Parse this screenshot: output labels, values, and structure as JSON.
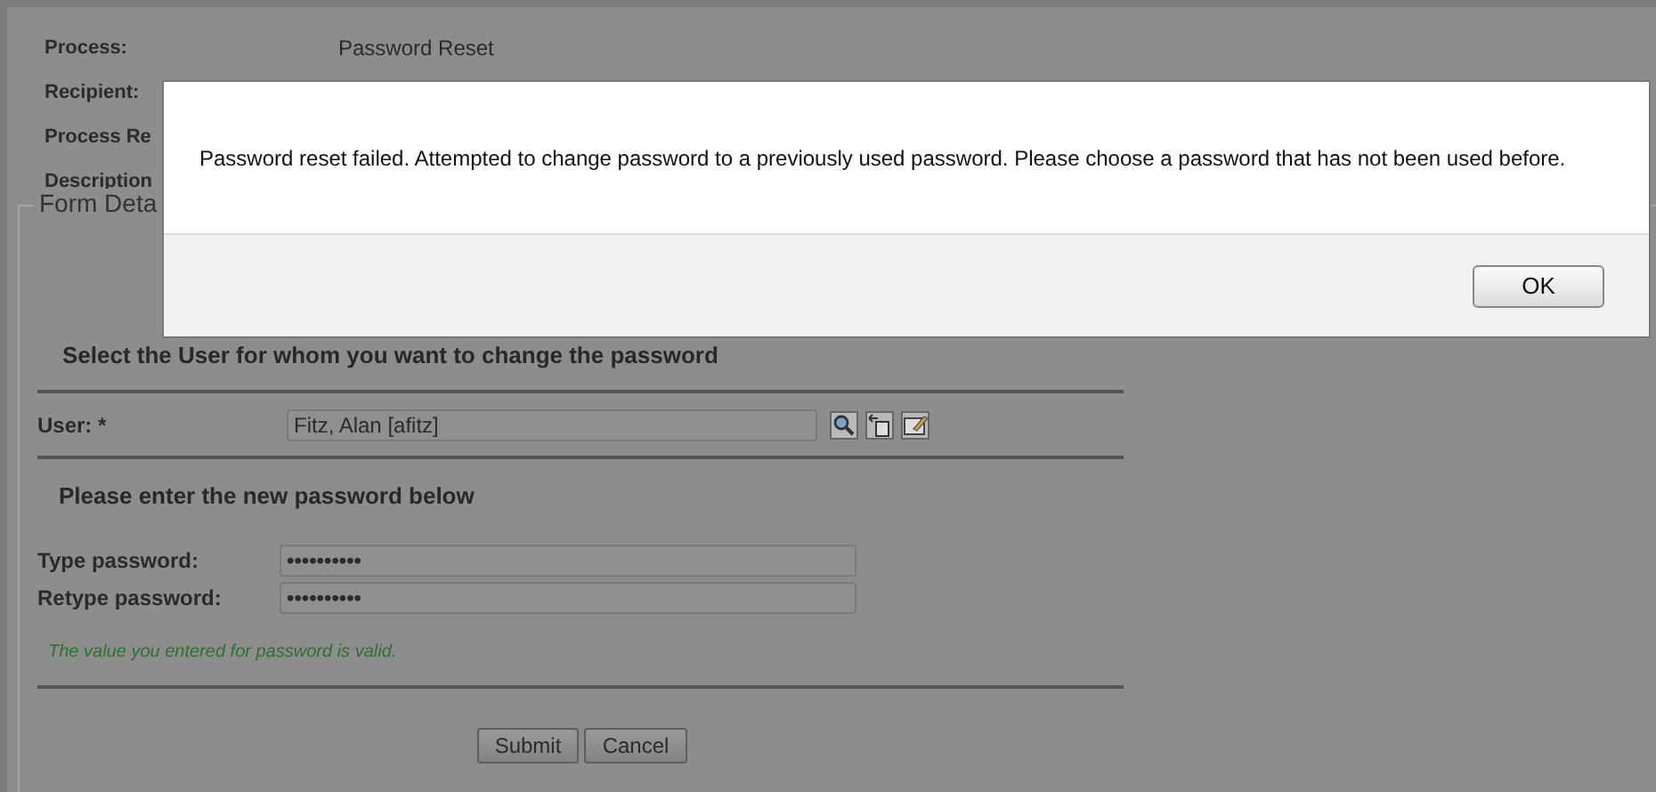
{
  "summary": [
    {
      "label": "Process:",
      "value": "Password Reset"
    },
    {
      "label": "Recipient:"
    },
    {
      "label": "Process Re"
    },
    {
      "label": "Description"
    }
  ],
  "fieldset": {
    "legend": "Form Deta"
  },
  "user_section": {
    "heading": "Select the User for whom you want to change the password",
    "label": "User: *",
    "value": "Fitz, Alan [afitz]"
  },
  "password_section": {
    "heading": "Please enter the new password below",
    "fields": [
      {
        "label": "Type password:",
        "value": "••••••••••"
      },
      {
        "label": "Retype password:",
        "value": "••••••••••"
      }
    ],
    "validation": "The value you entered for password is valid."
  },
  "buttons": [
    "Submit",
    "Cancel"
  ],
  "dialog": {
    "message": "Password reset failed. Attempted to change password to a previously used password. Please choose a password that has not been used before.",
    "button": "OK"
  }
}
